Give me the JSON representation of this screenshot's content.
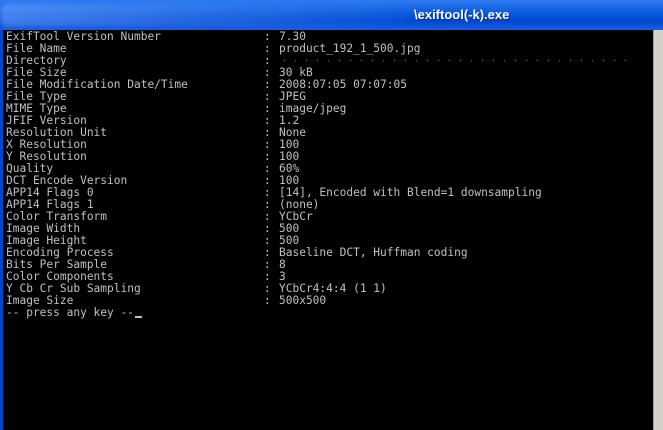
{
  "window": {
    "title": "\\exiftool(-k).exe"
  },
  "separator": ":",
  "rows": [
    {
      "label": "ExifTool Version Number",
      "value": "7.30"
    },
    {
      "label": "File Name",
      "value": "product_192_1_500.jpg"
    },
    {
      "label": "Directory",
      "value": ""
    },
    {
      "label": "File Size",
      "value": "30 kB"
    },
    {
      "label": "File Modification Date/Time",
      "value": "2008:07:05 07:07:05"
    },
    {
      "label": "File Type",
      "value": "JPEG"
    },
    {
      "label": "MIME Type",
      "value": "image/jpeg"
    },
    {
      "label": "JFIF Version",
      "value": "1.2"
    },
    {
      "label": "Resolution Unit",
      "value": "None"
    },
    {
      "label": "X Resolution",
      "value": "100"
    },
    {
      "label": "Y Resolution",
      "value": "100"
    },
    {
      "label": "Quality",
      "value": "60%"
    },
    {
      "label": "DCT Encode Version",
      "value": "100"
    },
    {
      "label": "APP14 Flags 0",
      "value": "[14], Encoded with Blend=1 downsampling"
    },
    {
      "label": "APP14 Flags 1",
      "value": "(none)"
    },
    {
      "label": "Color Transform",
      "value": "YCbCr"
    },
    {
      "label": "Image Width",
      "value": "500"
    },
    {
      "label": "Image Height",
      "value": "500"
    },
    {
      "label": "Encoding Process",
      "value": "Baseline DCT, Huffman coding"
    },
    {
      "label": "Bits Per Sample",
      "value": "8"
    },
    {
      "label": "Color Components",
      "value": "3"
    },
    {
      "label": "Y Cb Cr Sub Sampling",
      "value": "YCbCr4:4:4 (1 1)"
    },
    {
      "label": "Image Size",
      "value": "500x500"
    }
  ],
  "prompt": "-- press any key --"
}
